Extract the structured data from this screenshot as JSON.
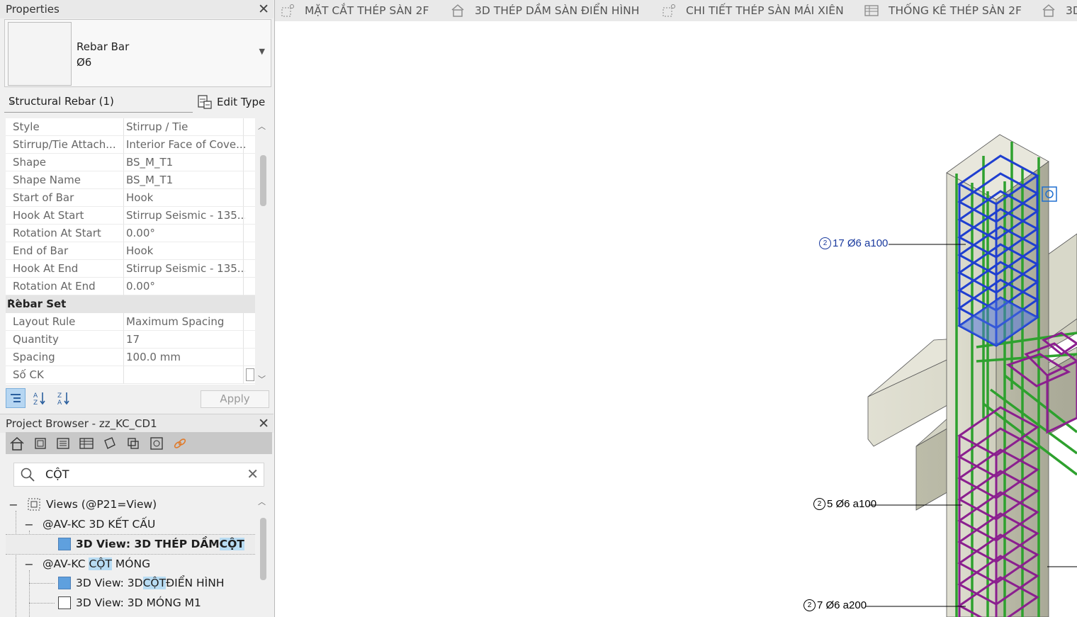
{
  "properties": {
    "title": "Properties",
    "type_name": "Rebar Bar",
    "type_size": "Ø6",
    "filter": "Structural Rebar (1)",
    "edit_type": "Edit Type",
    "rows": [
      {
        "k": "Style",
        "v": "Stirrup / Tie"
      },
      {
        "k": "Stirrup/Tie Attach...",
        "v": "Interior Face of Cove..."
      },
      {
        "k": "Shape",
        "v": "BS_M_T1"
      },
      {
        "k": "Shape Name",
        "v": "BS_M_T1"
      },
      {
        "k": "Start of Bar",
        "v": "Hook"
      },
      {
        "k": "Hook At Start",
        "v": "Stirrup Seismic - 135..."
      },
      {
        "k": "Rotation At Start",
        "v": "0.00°"
      },
      {
        "k": "End of Bar",
        "v": "Hook"
      },
      {
        "k": "Hook At End",
        "v": "Stirrup Seismic - 135..."
      },
      {
        "k": "Rotation At End",
        "v": "0.00°"
      }
    ],
    "group": "Rebar Set",
    "rows2": [
      {
        "k": "Layout Rule",
        "v": "Maximum Spacing"
      },
      {
        "k": "Quantity",
        "v": "17"
      },
      {
        "k": "Spacing",
        "v": "100.0 mm"
      },
      {
        "k": "Số CK",
        "v": ""
      }
    ],
    "apply": "Apply"
  },
  "browser": {
    "title": "Project Browser - zz_KC_CD1",
    "search": "CỘT",
    "tree": {
      "root": "Views (@P21=View)",
      "g1": "@AV-KC 3D KẾT CẤU",
      "n1_pre": "3D View: 3D THÉP DẦM ",
      "n1_hl": "CỘT",
      "g2_pre": "@AV-KC ",
      "g2_hl": "CỘT",
      "g2_post": " MÓNG",
      "n2_pre": "3D View: 3D ",
      "n2_hl": "CỘT",
      "n2_post": " ĐIỂN HÌNH",
      "n3": "3D View: 3D MÓNG M1"
    }
  },
  "tabs": [
    {
      "label": "MẶT CẮT THÉP SÀN 2F",
      "icon": "section-view-icon"
    },
    {
      "label": "3D THÉP DẦM SÀN ĐIỂN HÌNH",
      "icon": "3d-view-icon"
    },
    {
      "label": "CHI TIẾT THÉP SÀN MÁI XIÊN",
      "icon": "section-view-icon"
    },
    {
      "label": "THỐNG KÊ THÉP SÀN 2F",
      "icon": "schedule-icon"
    },
    {
      "label": "3D",
      "icon": "3d-view-icon"
    }
  ],
  "tags": {
    "t1_num": "2",
    "t1_text": "17 Ø6 a100",
    "t2_num": "2",
    "t2_text": "5 Ø6 a100",
    "t3_num": "2",
    "t3_text": "7 Ø6 a200"
  },
  "colors": {
    "concrete": "#d6d6c8",
    "stirrup_selected": "#1f3fd0",
    "stirrup_other": "#8b1f8f",
    "longitudinal_bar": "#2ea12e",
    "tag_selected": "#1a3a9e"
  }
}
